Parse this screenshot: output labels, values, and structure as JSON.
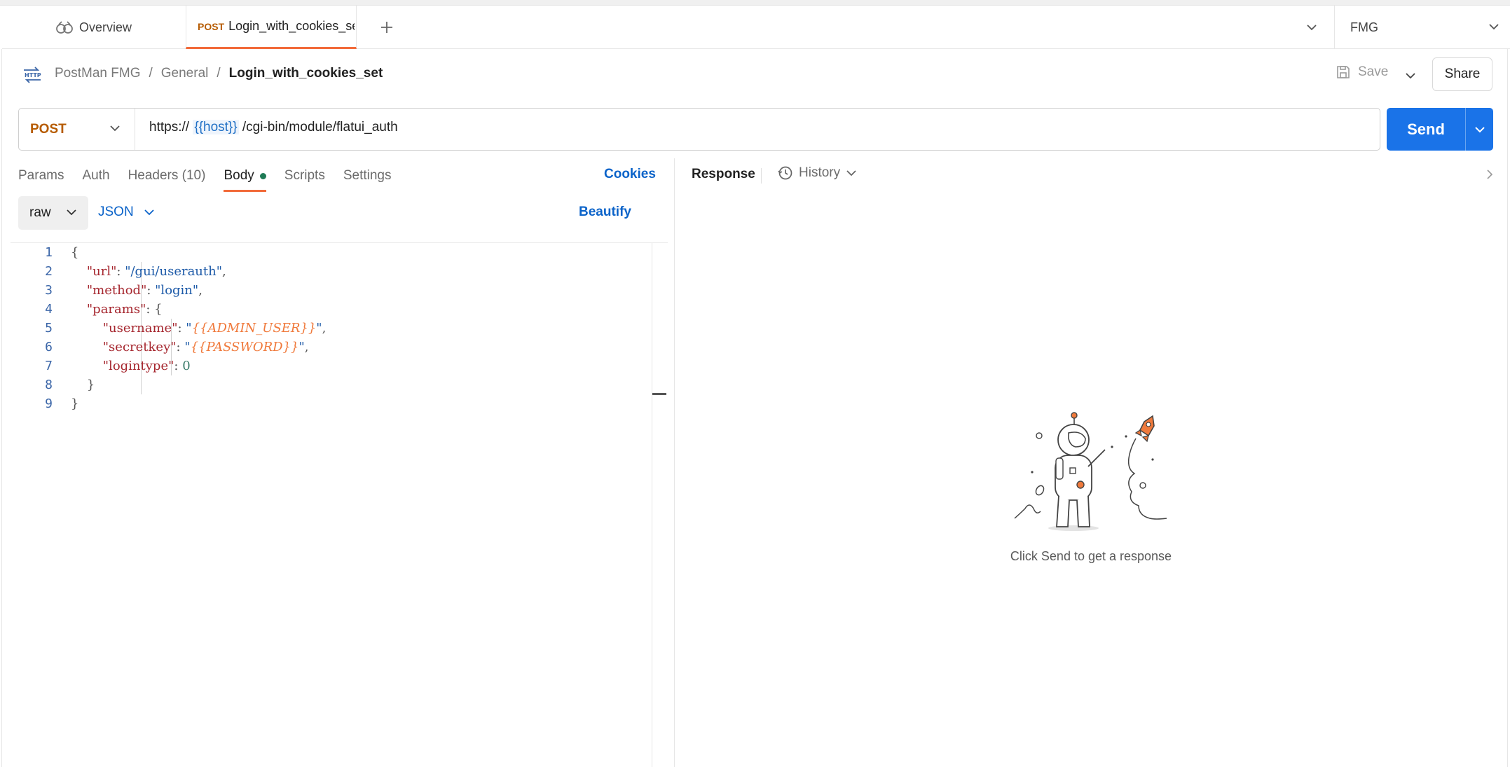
{
  "tabs": {
    "overview_label": "Overview",
    "active": {
      "method": "POST",
      "title": "Login_with_cookies_se"
    }
  },
  "environment": {
    "selected": "FMG"
  },
  "breadcrumb": {
    "items": [
      "PostMan FMG",
      "/",
      "General",
      "/",
      "Login_with_cookies_set"
    ]
  },
  "toolbar": {
    "save_label": "Save",
    "share_label": "Share"
  },
  "request": {
    "method": "POST",
    "url_prefix": "https://",
    "url_var": "{{host}}",
    "url_suffix": "/cgi-bin/module/flatui_auth",
    "send_label": "Send"
  },
  "request_tabs": [
    {
      "label": "Params"
    },
    {
      "label": "Auth"
    },
    {
      "label": "Headers (10)"
    },
    {
      "label": "Body"
    },
    {
      "label": "Scripts"
    },
    {
      "label": "Settings"
    }
  ],
  "cookies_label": "Cookies",
  "body": {
    "mode": "raw",
    "language": "JSON",
    "beautify_label": "Beautify",
    "line_numbers": [
      "1",
      "2",
      "3",
      "4",
      "5",
      "6",
      "7",
      "8",
      "9"
    ],
    "lines": [
      {
        "indent": "",
        "parts": [
          [
            "p",
            "{"
          ]
        ]
      },
      {
        "indent": "    ",
        "parts": [
          [
            "k",
            "\"url\""
          ],
          [
            "p",
            ": "
          ],
          [
            "s",
            "\"/gui/userauth\""
          ],
          [
            "p",
            ","
          ]
        ]
      },
      {
        "indent": "    ",
        "parts": [
          [
            "k",
            "\"method\""
          ],
          [
            "p",
            ": "
          ],
          [
            "s",
            "\"login\""
          ],
          [
            "p",
            ","
          ]
        ]
      },
      {
        "indent": "    ",
        "parts": [
          [
            "k",
            "\"params\""
          ],
          [
            "p",
            ": {"
          ]
        ]
      },
      {
        "indent": "        ",
        "parts": [
          [
            "k",
            "\"username\""
          ],
          [
            "p",
            ": "
          ],
          [
            "s",
            "\""
          ],
          [
            "v",
            "{{ADMIN_USER}}"
          ],
          [
            "s",
            "\""
          ],
          [
            "p",
            ","
          ]
        ]
      },
      {
        "indent": "        ",
        "parts": [
          [
            "k",
            "\"secretkey\""
          ],
          [
            "p",
            ": "
          ],
          [
            "s",
            "\""
          ],
          [
            "v",
            "{{PASSWORD}}"
          ],
          [
            "s",
            "\""
          ],
          [
            "p",
            ","
          ]
        ]
      },
      {
        "indent": "        ",
        "parts": [
          [
            "k",
            "\"logintype\""
          ],
          [
            "p",
            ": "
          ],
          [
            "n",
            "0"
          ]
        ]
      },
      {
        "indent": "    ",
        "parts": [
          [
            "p",
            "}"
          ]
        ]
      },
      {
        "indent": "",
        "parts": [
          [
            "p",
            "}"
          ]
        ]
      }
    ]
  },
  "response": {
    "title": "Response",
    "history_label": "History",
    "empty_message": "Click Send to get a response"
  },
  "colors": {
    "accent_tab": "#f26b3a",
    "send_button": "#1a73e8",
    "link_blue": "#0b63c9",
    "method_post": "#b65b00"
  }
}
